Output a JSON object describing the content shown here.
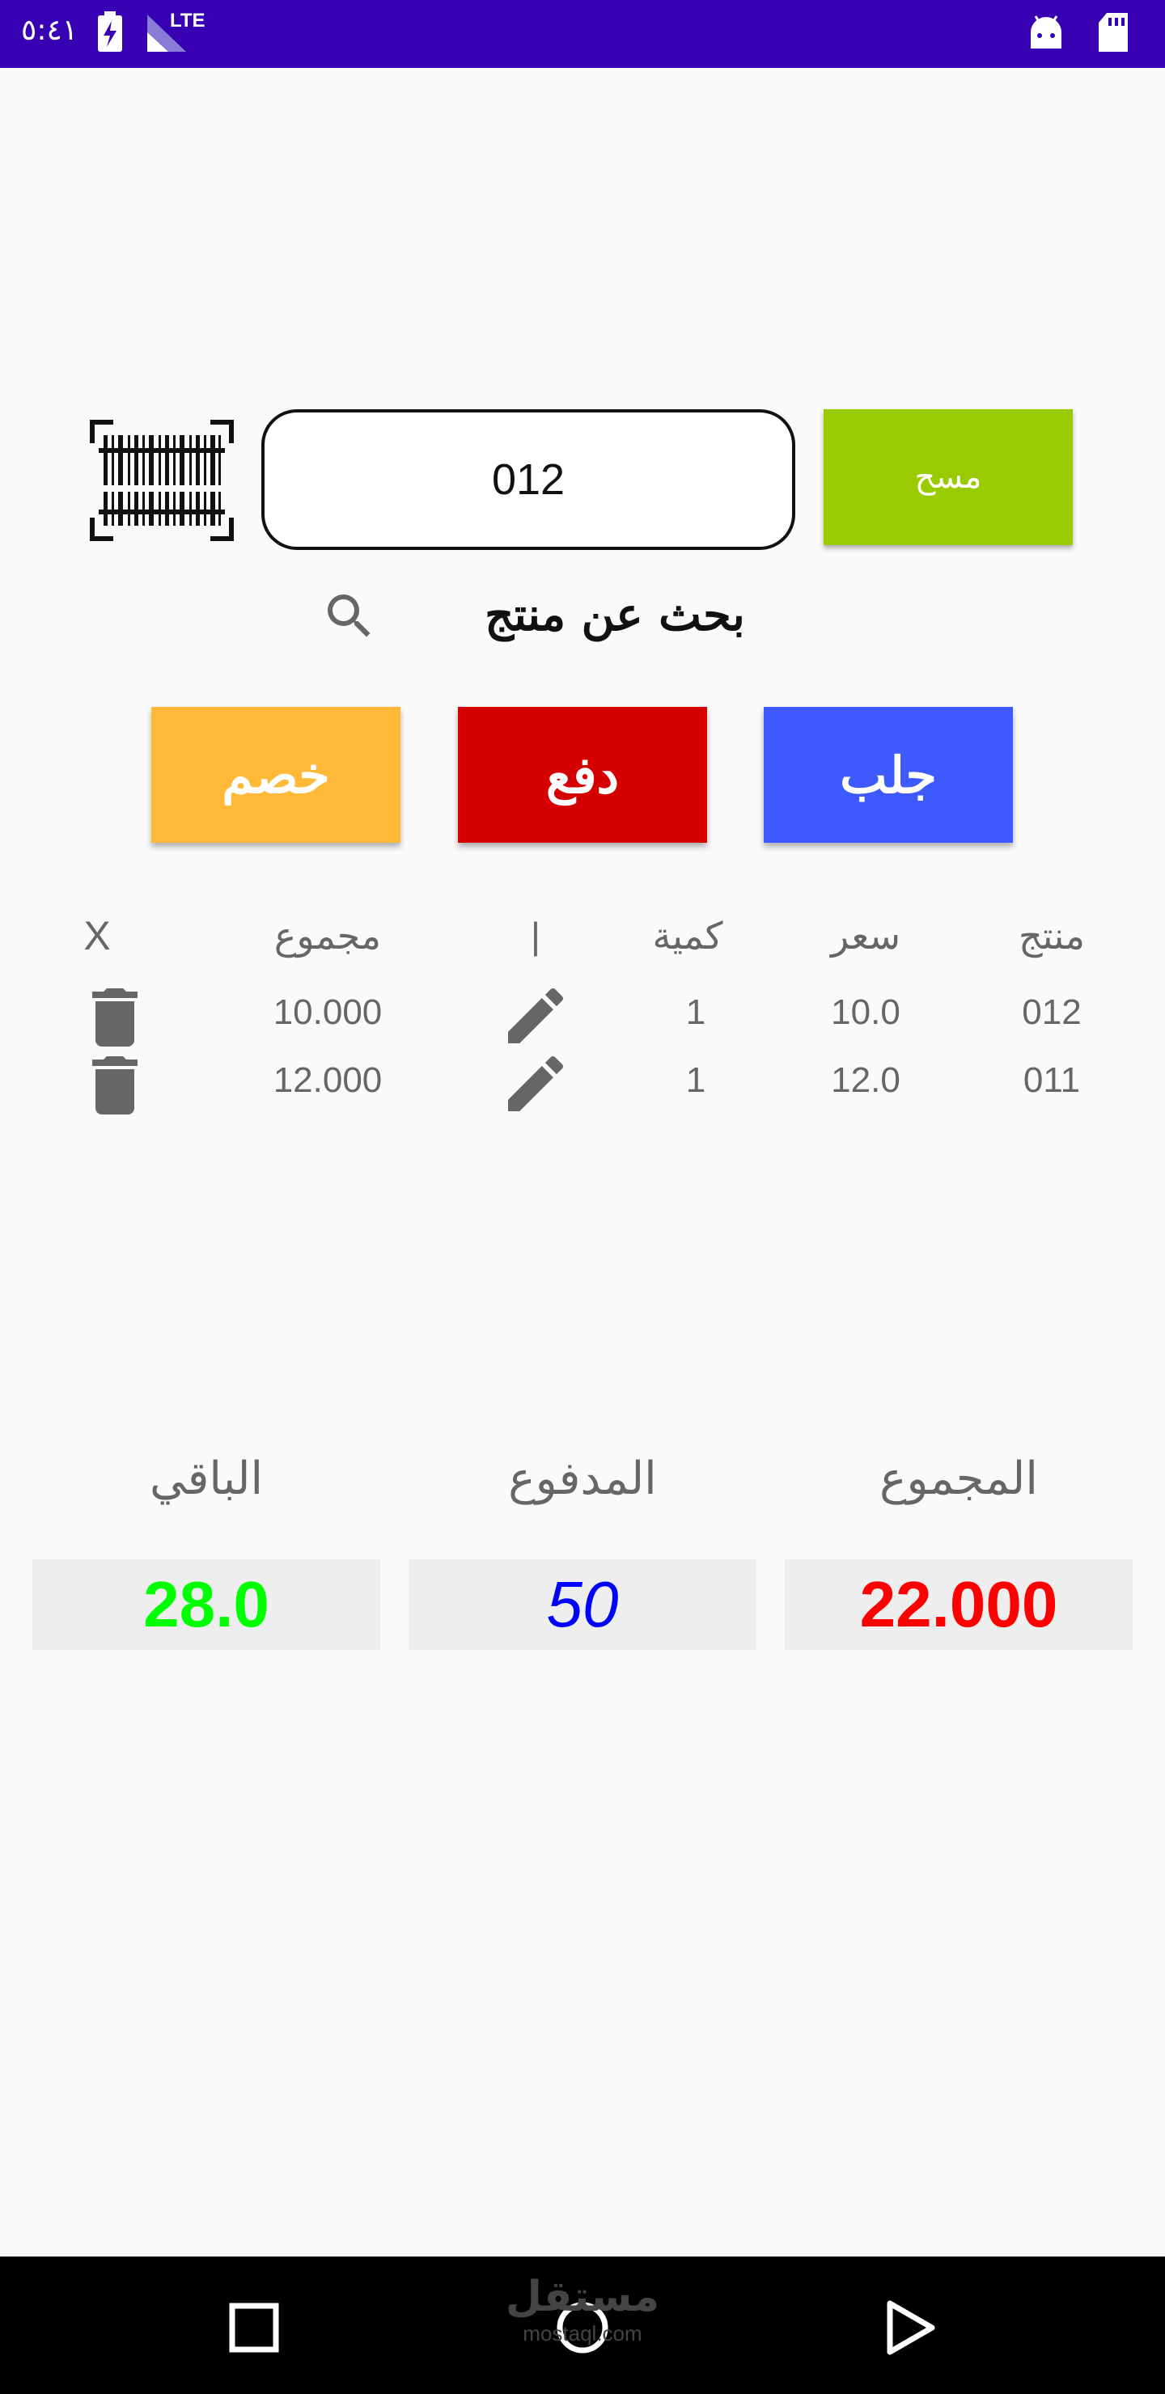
{
  "status_bar": {
    "time": "٥:٤١",
    "network": "LTE"
  },
  "search": {
    "input_value": "012",
    "scan_button_label": "مسح",
    "search_label": "بحث عن منتج"
  },
  "actions": {
    "fetch_label": "جلب",
    "pay_label": "دفع",
    "discount_label": "خصم"
  },
  "table": {
    "headers": {
      "product": "منتج",
      "price": "سعر",
      "quantity": "كمية",
      "edit": "|",
      "total": "مجموع",
      "delete": "X"
    },
    "rows": [
      {
        "product": "012",
        "price": "10.0",
        "quantity": "1",
        "total": "10.000"
      },
      {
        "product": "011",
        "price": "12.0",
        "quantity": "1",
        "total": "12.000"
      }
    ]
  },
  "totals": {
    "total_label": "المجموع",
    "total_value": "22.000",
    "paid_label": "المدفوع",
    "paid_value": "50",
    "remaining_label": "الباقي",
    "remaining_value": "28.0"
  },
  "colors": {
    "status_bar": "#3700b3",
    "scan_button": "#99cc00",
    "fetch_button": "#3d5afe",
    "pay_button": "#d50000",
    "discount_button": "#ffb837",
    "total_value": "#ff0000",
    "paid_value": "#0000ff",
    "remaining_value": "#00ff00"
  },
  "watermark": {
    "brand": "مستقل",
    "domain": "mostaql.com"
  }
}
